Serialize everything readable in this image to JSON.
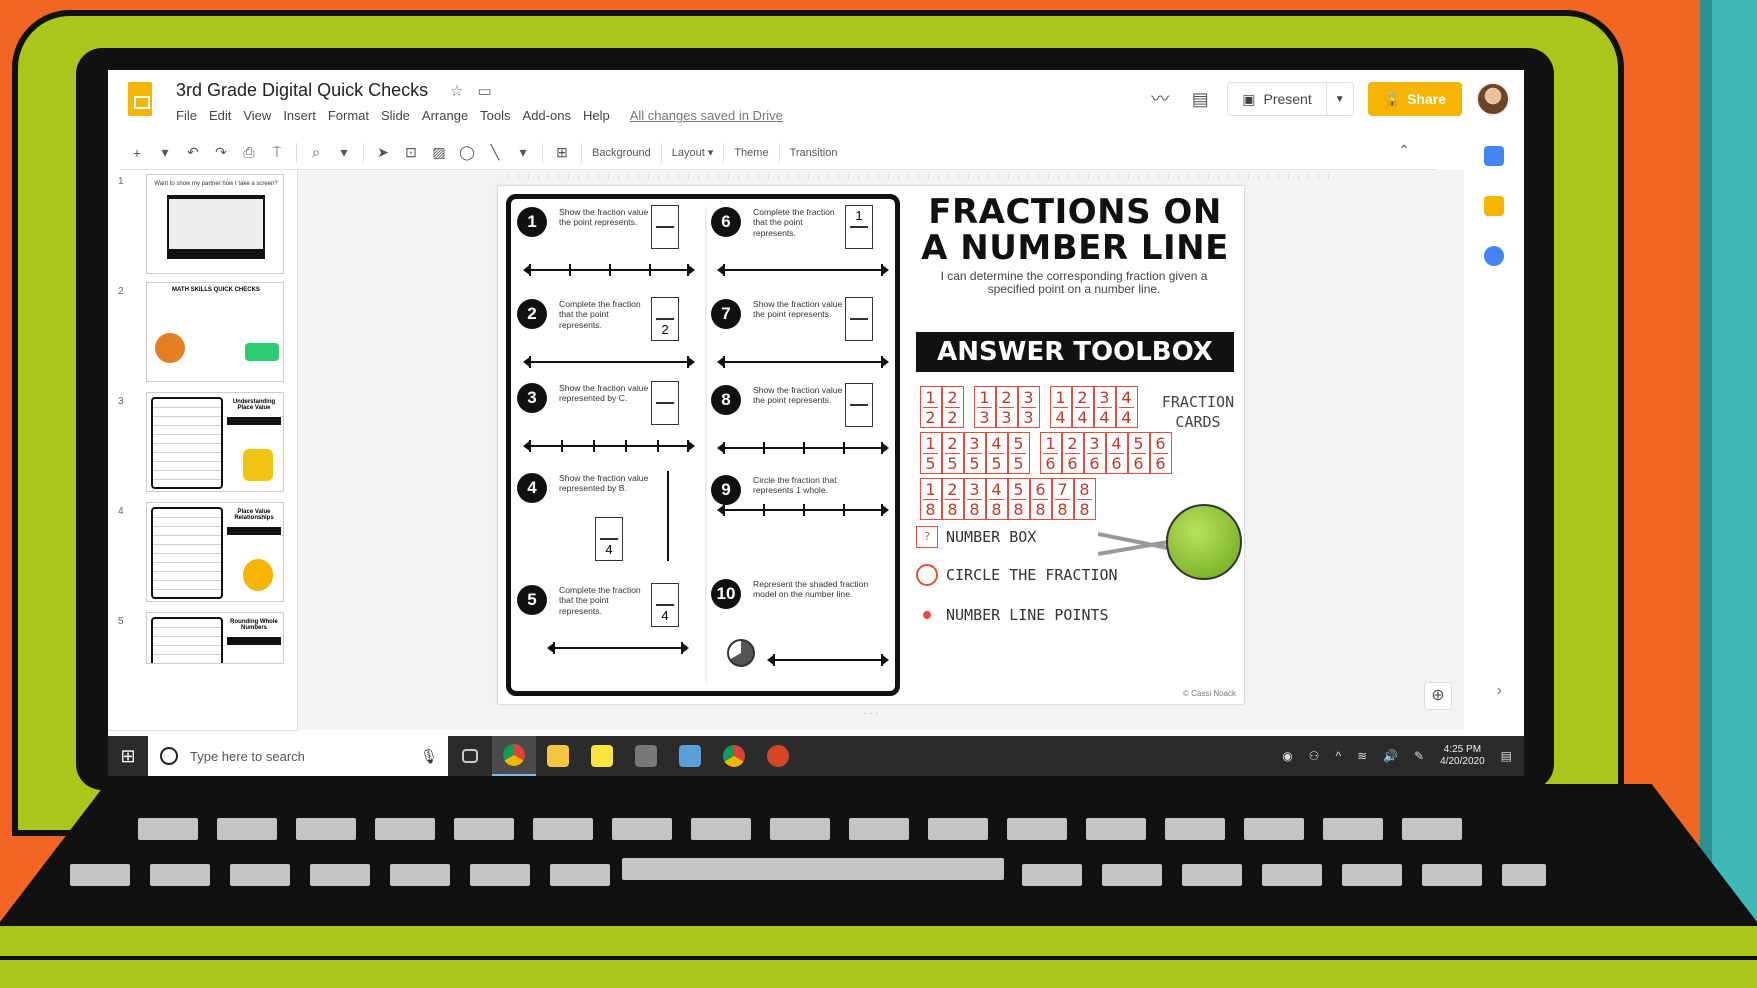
{
  "app": {
    "title": "3rd Grade Digital Quick Checks",
    "menu": [
      "File",
      "Edit",
      "View",
      "Insert",
      "Format",
      "Slide",
      "Arrange",
      "Tools",
      "Add-ons",
      "Help"
    ],
    "saved_status": "All changes saved in Drive",
    "present_label": "Present",
    "share_label": "Share"
  },
  "toolbar": {
    "background_label": "Background",
    "layout_label": "Layout",
    "theme_label": "Theme",
    "transition_label": "Transition"
  },
  "filmstrip": {
    "slides": [
      {
        "num": "1",
        "caption": "Want to show my partner how I take a screen?"
      },
      {
        "num": "2",
        "caption": "MATH SKILLS QUICK CHECKS"
      },
      {
        "num": "3",
        "caption": "Understanding Place Value"
      },
      {
        "num": "4",
        "caption": "Place Value Relationships"
      },
      {
        "num": "5",
        "caption": "Rounding Whole Numbers"
      }
    ]
  },
  "slide": {
    "title": "FRACTIONS ON A NUMBER LINE",
    "objective": "I can determine the corresponding fraction given a specified point on a number line.",
    "toolbox_title": "ANSWER TOOLBOX",
    "fraction_cards_label": "FRACTION CARDS",
    "legend": {
      "number_box": "NUMBER BOX",
      "circle": "CIRCLE THE FRACTION",
      "points": "NUMBER LINE POINTS"
    },
    "copyright": "© Cassi Noack",
    "questions": [
      {
        "num": "1",
        "text": "Show the fraction value the point represents."
      },
      {
        "num": "2",
        "text": "Complete the fraction that the point represents.",
        "den": "2"
      },
      {
        "num": "3",
        "text": "Show the fraction value represented by C."
      },
      {
        "num": "4",
        "text": "Show the fraction value represented by B.",
        "den": "4"
      },
      {
        "num": "5",
        "text": "Complete the fraction that the point represents.",
        "den": "4"
      },
      {
        "num": "6",
        "text": "Complete the fraction that the point represents.",
        "numr": "1"
      },
      {
        "num": "7",
        "text": "Show the fraction value the point represents."
      },
      {
        "num": "8",
        "text": "Show the fraction value the point represents."
      },
      {
        "num": "9",
        "text": "Circle the fraction that represents 1 whole."
      },
      {
        "num": "10",
        "text": "Represent the shaded fraction model on the number line."
      }
    ],
    "card_rows": [
      [
        [
          "1",
          "2"
        ],
        [
          "2",
          "2"
        ],
        null,
        [
          "1",
          "3"
        ],
        [
          "2",
          "3"
        ],
        [
          "3",
          "3"
        ],
        null,
        [
          "1",
          "4"
        ],
        [
          "2",
          "4"
        ],
        [
          "3",
          "4"
        ],
        [
          "4",
          "4"
        ]
      ],
      [
        [
          "1",
          "5"
        ],
        [
          "2",
          "5"
        ],
        [
          "3",
          "5"
        ],
        [
          "4",
          "5"
        ],
        [
          "5",
          "5"
        ],
        null,
        [
          "1",
          "6"
        ],
        [
          "2",
          "6"
        ],
        [
          "3",
          "6"
        ],
        [
          "4",
          "6"
        ],
        [
          "5",
          "6"
        ],
        [
          "6",
          "6"
        ]
      ],
      [
        [
          "1",
          "8"
        ],
        [
          "2",
          "8"
        ],
        [
          "3",
          "8"
        ],
        [
          "4",
          "8"
        ],
        [
          "5",
          "8"
        ],
        [
          "6",
          "8"
        ],
        [
          "7",
          "8"
        ],
        [
          "8",
          "8"
        ]
      ]
    ]
  },
  "taskbar": {
    "search_placeholder": "Type here to search",
    "time": "4:25 PM",
    "date": "4/20/2020"
  },
  "colors": {
    "background": "#f26522",
    "laptop": "#abc51b",
    "share": "#f4b400",
    "cards": "#e74c3c"
  }
}
